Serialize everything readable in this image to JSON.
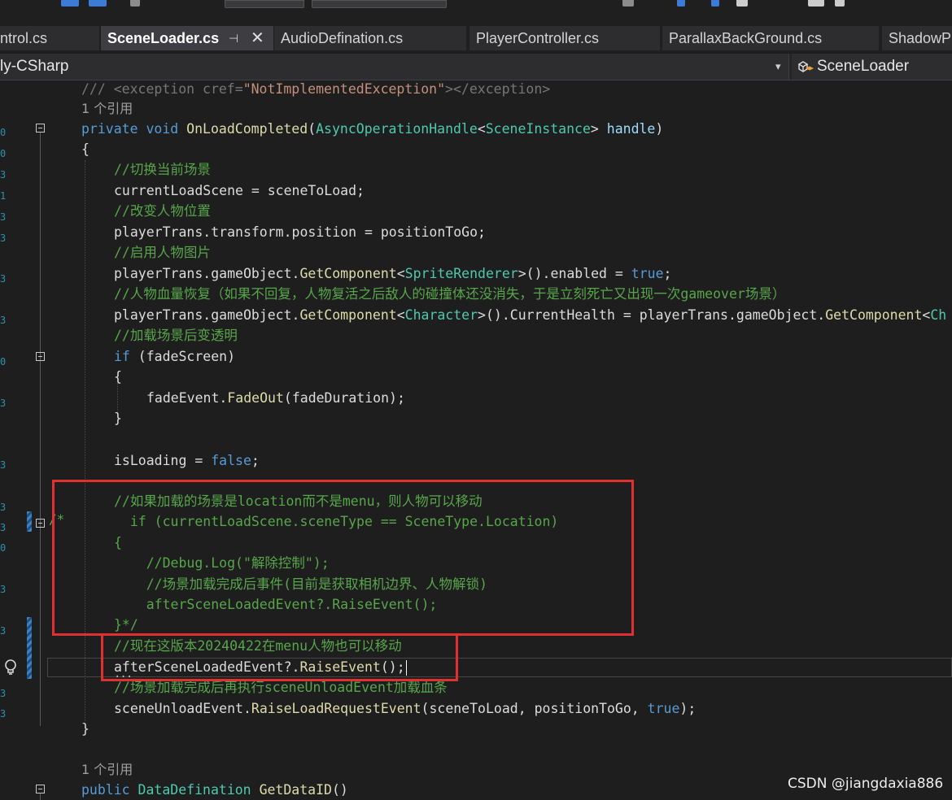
{
  "tabs": [
    {
      "label": "ntrol.cs",
      "active": false
    },
    {
      "label": "SceneLoader.cs",
      "active": true,
      "pin": "⊣",
      "close": "✕"
    },
    {
      "label": "AudioDefination.cs",
      "active": false
    },
    {
      "label": "PlayerController.cs",
      "active": false
    },
    {
      "label": "ParallaxBackGround.cs",
      "active": false
    },
    {
      "label": "ShadowP",
      "active": false
    }
  ],
  "navbar": {
    "project": "ly-CSharp",
    "dropdown_icon": "▾",
    "class_icon": "class-icon",
    "class_name": "SceneLoader"
  },
  "code": {
    "l01": {
      "a": "/// <exception cref=",
      "b": "\"NotImplementedException\"",
      "c": "></exception>"
    },
    "l02": "1 个引用",
    "l03": {
      "kw1": "private",
      "kw2": "void",
      "name": "OnLoadCompleted",
      "p1": "(",
      "t1": "AsyncOperationHandle",
      "lt": "<",
      "t2": "SceneInstance",
      "gt": ">",
      "param": " handle",
      "p2": ")"
    },
    "l04": "{",
    "l05": "//切换当前场景",
    "l06": "currentLoadScene = sceneToLoad;",
    "l07": "//改变人物位置",
    "l08": "playerTrans.transform.position = positionToGo;",
    "l09": "//启用人物图片",
    "l10": {
      "a": "playerTrans.gameObject.",
      "m": "GetComponent",
      "lt": "<",
      "t": "SpriteRenderer",
      "gt": ">().enabled = ",
      "kw": "true",
      "end": ";"
    },
    "l11": "//人物血量恢复（如果不回复，人物复活之后敌人的碰撞体还没消失，于是立刻死亡又出现一次gameover场景）",
    "l12": {
      "a": "playerTrans.gameObject.",
      "m": "GetComponent",
      "lt": "<",
      "t": "Character",
      "gt": ">().CurrentHealth = playerTrans.gameObject.",
      "m2": "GetComponent",
      "lt2": "<",
      "t2": "Ch"
    },
    "l13": "//加载场景后变透明",
    "l14": {
      "kw": "if",
      "rest": " (fadeScreen)"
    },
    "l15": "{",
    "l16": {
      "a": "fadeEvent.",
      "m": "FadeOut",
      "rest": "(fadeDuration);"
    },
    "l17": "}",
    "l19": {
      "a": "isLoading = ",
      "kw": "false",
      "end": ";"
    },
    "l21": "//如果加载的场景是location而不是menu，则人物可以移动",
    "l22": "  if (currentLoadScene.sceneType == SceneType.Location)",
    "l23": "{",
    "l24": "    //Debug.Log(\"解除控制\");",
    "l25": "    //场景加载完成后事件(目前是获取相机边界、人物解锁)",
    "l26": "    afterSceneLoadedEvent?.RaiseEvent();",
    "l27": "}*/",
    "l28": "//现在这版本20240422在menu人物也可以移动",
    "l29": {
      "a": "afterSceneLoadedEvent?.",
      "m": "RaiseEvent",
      "rest": "();"
    },
    "l30": "//场景加载完成后再执行sceneUnloadEvent加载血条",
    "l31": {
      "a": "sceneUnloadEvent.",
      "m": "RaiseLoadRequestEvent",
      "rest": "(sceneToLoad, positionToGo, ",
      "kw": "true",
      "end": ");"
    },
    "l32": "}",
    "l34": "1 个引用",
    "l35": {
      "kw": "public",
      "t": "DataDefination",
      "m": "GetDataID",
      "rest": "()"
    }
  },
  "gutter": {
    "comment_star": "/*",
    "ellipsis": "..."
  },
  "icons": {
    "lightbulb": "lightbulb-icon"
  },
  "watermark": "CSDN @jiangdaxia886",
  "colors": {
    "highlight_box": "#e03030",
    "comment": "#57a64a",
    "keyword": "#569cd6",
    "type": "#4ec9b0",
    "method": "#dcdcaa"
  }
}
